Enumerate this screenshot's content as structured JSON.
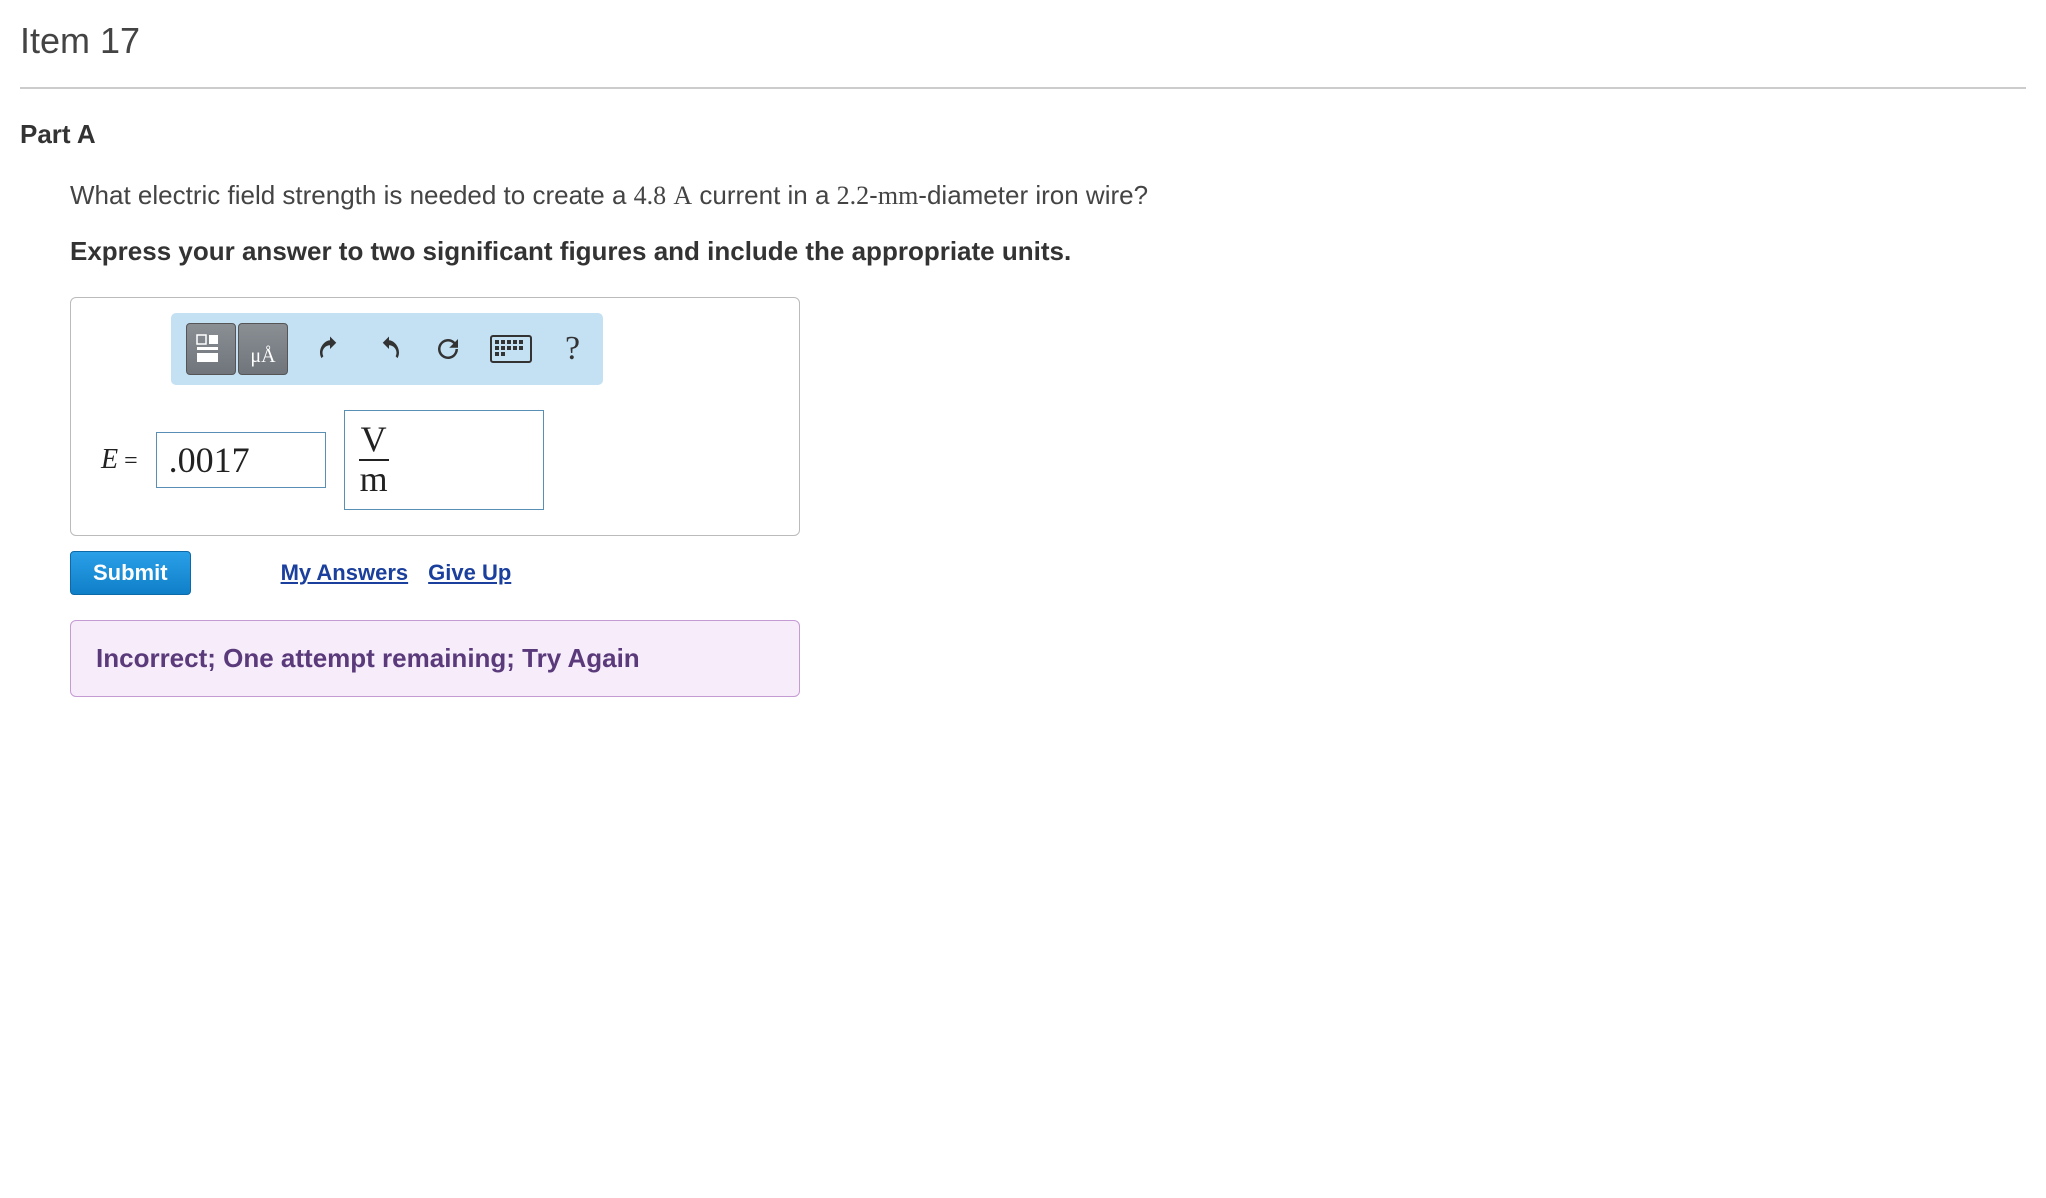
{
  "item": {
    "title": "Item 17"
  },
  "part": {
    "label": "Part A"
  },
  "question": {
    "prefix": "What electric field strength is needed to create a ",
    "current_value": "4.8",
    "current_unit": "A",
    "mid": " current in a ",
    "diameter_value": "2.2",
    "diameter_unit": "mm",
    "suffix": "-diameter iron wire?"
  },
  "instructions": "Express your answer to two significant figures and include the appropriate units.",
  "toolbar": {
    "template_btn_name": "template-icon",
    "units_btn_label": "μÅ",
    "undo_name": "undo-icon",
    "redo_name": "redo-icon",
    "reset_name": "reset-icon",
    "keyboard_name": "keyboard-icon",
    "help_label": "?"
  },
  "answer": {
    "variable": "E",
    "equals": " = ",
    "value": ".0017",
    "unit_numerator": "V",
    "unit_denominator": "m"
  },
  "actions": {
    "submit": "Submit",
    "my_answers": "My Answers",
    "give_up": "Give Up"
  },
  "feedback": {
    "message": "Incorrect; One attempt remaining; Try Again"
  }
}
